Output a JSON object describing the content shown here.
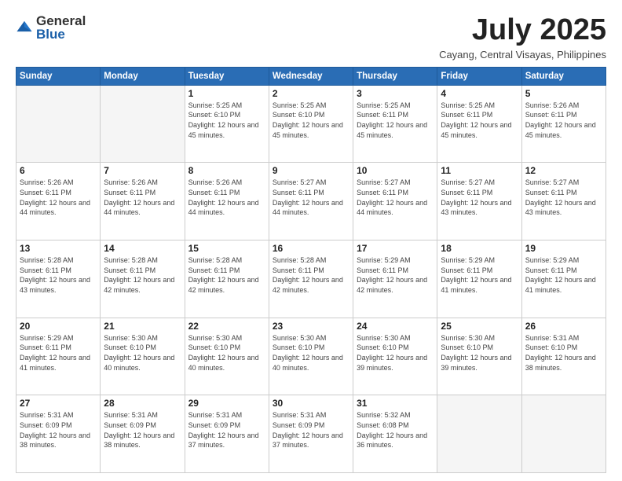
{
  "header": {
    "logo_general": "General",
    "logo_blue": "Blue",
    "month_title": "July 2025",
    "subtitle": "Cayang, Central Visayas, Philippines"
  },
  "weekdays": [
    "Sunday",
    "Monday",
    "Tuesday",
    "Wednesday",
    "Thursday",
    "Friday",
    "Saturday"
  ],
  "weeks": [
    [
      {
        "day": "",
        "info": ""
      },
      {
        "day": "",
        "info": ""
      },
      {
        "day": "1",
        "info": "Sunrise: 5:25 AM\nSunset: 6:10 PM\nDaylight: 12 hours and 45 minutes."
      },
      {
        "day": "2",
        "info": "Sunrise: 5:25 AM\nSunset: 6:10 PM\nDaylight: 12 hours and 45 minutes."
      },
      {
        "day": "3",
        "info": "Sunrise: 5:25 AM\nSunset: 6:11 PM\nDaylight: 12 hours and 45 minutes."
      },
      {
        "day": "4",
        "info": "Sunrise: 5:25 AM\nSunset: 6:11 PM\nDaylight: 12 hours and 45 minutes."
      },
      {
        "day": "5",
        "info": "Sunrise: 5:26 AM\nSunset: 6:11 PM\nDaylight: 12 hours and 45 minutes."
      }
    ],
    [
      {
        "day": "6",
        "info": "Sunrise: 5:26 AM\nSunset: 6:11 PM\nDaylight: 12 hours and 44 minutes."
      },
      {
        "day": "7",
        "info": "Sunrise: 5:26 AM\nSunset: 6:11 PM\nDaylight: 12 hours and 44 minutes."
      },
      {
        "day": "8",
        "info": "Sunrise: 5:26 AM\nSunset: 6:11 PM\nDaylight: 12 hours and 44 minutes."
      },
      {
        "day": "9",
        "info": "Sunrise: 5:27 AM\nSunset: 6:11 PM\nDaylight: 12 hours and 44 minutes."
      },
      {
        "day": "10",
        "info": "Sunrise: 5:27 AM\nSunset: 6:11 PM\nDaylight: 12 hours and 44 minutes."
      },
      {
        "day": "11",
        "info": "Sunrise: 5:27 AM\nSunset: 6:11 PM\nDaylight: 12 hours and 43 minutes."
      },
      {
        "day": "12",
        "info": "Sunrise: 5:27 AM\nSunset: 6:11 PM\nDaylight: 12 hours and 43 minutes."
      }
    ],
    [
      {
        "day": "13",
        "info": "Sunrise: 5:28 AM\nSunset: 6:11 PM\nDaylight: 12 hours and 43 minutes."
      },
      {
        "day": "14",
        "info": "Sunrise: 5:28 AM\nSunset: 6:11 PM\nDaylight: 12 hours and 42 minutes."
      },
      {
        "day": "15",
        "info": "Sunrise: 5:28 AM\nSunset: 6:11 PM\nDaylight: 12 hours and 42 minutes."
      },
      {
        "day": "16",
        "info": "Sunrise: 5:28 AM\nSunset: 6:11 PM\nDaylight: 12 hours and 42 minutes."
      },
      {
        "day": "17",
        "info": "Sunrise: 5:29 AM\nSunset: 6:11 PM\nDaylight: 12 hours and 42 minutes."
      },
      {
        "day": "18",
        "info": "Sunrise: 5:29 AM\nSunset: 6:11 PM\nDaylight: 12 hours and 41 minutes."
      },
      {
        "day": "19",
        "info": "Sunrise: 5:29 AM\nSunset: 6:11 PM\nDaylight: 12 hours and 41 minutes."
      }
    ],
    [
      {
        "day": "20",
        "info": "Sunrise: 5:29 AM\nSunset: 6:11 PM\nDaylight: 12 hours and 41 minutes."
      },
      {
        "day": "21",
        "info": "Sunrise: 5:30 AM\nSunset: 6:10 PM\nDaylight: 12 hours and 40 minutes."
      },
      {
        "day": "22",
        "info": "Sunrise: 5:30 AM\nSunset: 6:10 PM\nDaylight: 12 hours and 40 minutes."
      },
      {
        "day": "23",
        "info": "Sunrise: 5:30 AM\nSunset: 6:10 PM\nDaylight: 12 hours and 40 minutes."
      },
      {
        "day": "24",
        "info": "Sunrise: 5:30 AM\nSunset: 6:10 PM\nDaylight: 12 hours and 39 minutes."
      },
      {
        "day": "25",
        "info": "Sunrise: 5:30 AM\nSunset: 6:10 PM\nDaylight: 12 hours and 39 minutes."
      },
      {
        "day": "26",
        "info": "Sunrise: 5:31 AM\nSunset: 6:10 PM\nDaylight: 12 hours and 38 minutes."
      }
    ],
    [
      {
        "day": "27",
        "info": "Sunrise: 5:31 AM\nSunset: 6:09 PM\nDaylight: 12 hours and 38 minutes."
      },
      {
        "day": "28",
        "info": "Sunrise: 5:31 AM\nSunset: 6:09 PM\nDaylight: 12 hours and 38 minutes."
      },
      {
        "day": "29",
        "info": "Sunrise: 5:31 AM\nSunset: 6:09 PM\nDaylight: 12 hours and 37 minutes."
      },
      {
        "day": "30",
        "info": "Sunrise: 5:31 AM\nSunset: 6:09 PM\nDaylight: 12 hours and 37 minutes."
      },
      {
        "day": "31",
        "info": "Sunrise: 5:32 AM\nSunset: 6:08 PM\nDaylight: 12 hours and 36 minutes."
      },
      {
        "day": "",
        "info": ""
      },
      {
        "day": "",
        "info": ""
      }
    ]
  ]
}
